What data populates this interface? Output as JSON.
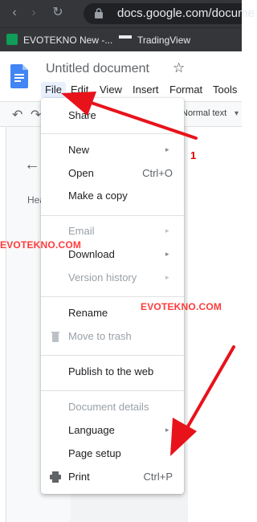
{
  "browser": {
    "url": "docs.google.com/docume",
    "bookmarks": [
      {
        "label": "EVOTEKNO New -...",
        "icon": "sheets-icon"
      },
      {
        "label": "TradingView",
        "icon": "tradingview-icon"
      }
    ]
  },
  "docs": {
    "title": "Untitled document",
    "menubar": [
      "File",
      "Edit",
      "View",
      "Insert",
      "Format",
      "Tools"
    ],
    "toolbar_style": "Normal text",
    "outline_text": "Head will a"
  },
  "file_menu": {
    "items": [
      {
        "label": "Share",
        "disabled": false
      },
      {
        "label": "New",
        "submenu": true
      },
      {
        "label": "Open",
        "shortcut": "Ctrl+O"
      },
      {
        "label": "Make a copy"
      },
      {
        "label": "Email",
        "disabled": true,
        "submenu": true
      },
      {
        "label": "Download",
        "submenu": true
      },
      {
        "label": "Version history",
        "disabled": true,
        "submenu": true
      },
      {
        "label": "Rename"
      },
      {
        "label": "Move to trash",
        "disabled": true,
        "icon": "trash-icon"
      },
      {
        "label": "Publish to the web"
      },
      {
        "label": "Document details",
        "disabled": true
      },
      {
        "label": "Language",
        "submenu": true
      },
      {
        "label": "Page setup"
      },
      {
        "label": "Print",
        "shortcut": "Ctrl+P",
        "icon": "printer-icon"
      }
    ],
    "submenu_arrow": "▸"
  },
  "annotations": {
    "watermark": "EVOTEKNO.COM",
    "watermark_left": "EVOTEKNO.COM",
    "step_number": "1",
    "arrow_color": "#e8121b"
  }
}
